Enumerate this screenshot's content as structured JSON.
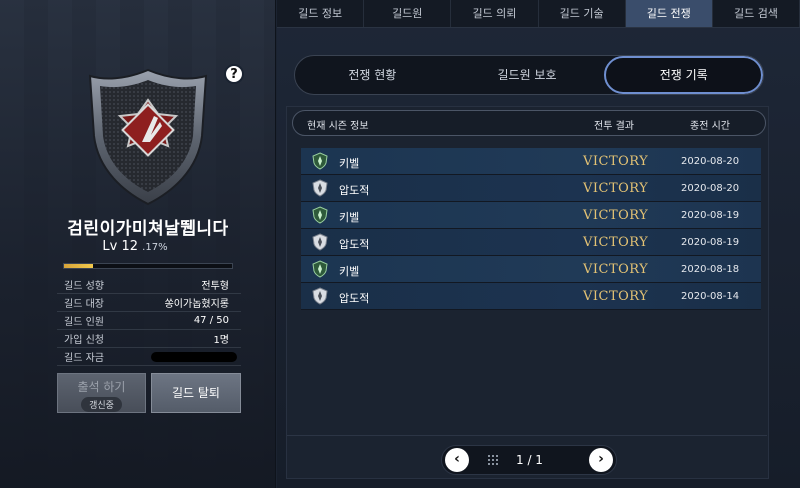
{
  "guild": {
    "name": "검린이가미쳐날뛥니다",
    "level_label": "Lv 12",
    "level_pct_text": ".17%",
    "level_progress": 0.17,
    "help_icon": "?",
    "info": [
      {
        "key": "길드 성향",
        "value": "전투형"
      },
      {
        "key": "길드 대장",
        "value": "쏭이가놉혔지롱"
      },
      {
        "key": "길드 인원",
        "value": "47 / 50"
      },
      {
        "key": "가입 신청",
        "value": "1명"
      },
      {
        "key": "길드 자금",
        "value": ""
      }
    ],
    "checkin_label": "출석 하기",
    "checkin_status": "갱신중",
    "leave_label": "길드 탈퇴"
  },
  "tabs": [
    "길드 정보",
    "길드원",
    "길드 의뢰",
    "길드 기술",
    "길드 전쟁",
    "길드 검색"
  ],
  "active_tab": 4,
  "subtabs": [
    "전쟁 현황",
    "길드원 보호",
    "전쟁 기록"
  ],
  "active_subtab": 2,
  "list": {
    "header_col1": "현재 시즌 정보",
    "header_col2": "전투 결과",
    "header_col3": "종전 시간",
    "rows": [
      {
        "opponent": "키벨",
        "result": "VICTORY",
        "date": "2020-08-20",
        "icon": "green-crest-icon"
      },
      {
        "opponent": "압도적",
        "result": "VICTORY",
        "date": "2020-08-20",
        "icon": "grey-crest-icon"
      },
      {
        "opponent": "키벨",
        "result": "VICTORY",
        "date": "2020-08-19",
        "icon": "green-crest-icon"
      },
      {
        "opponent": "압도적",
        "result": "VICTORY",
        "date": "2020-08-19",
        "icon": "grey-crest-icon"
      },
      {
        "opponent": "키벨",
        "result": "VICTORY",
        "date": "2020-08-18",
        "icon": "green-crest-icon"
      },
      {
        "opponent": "압도적",
        "result": "VICTORY",
        "date": "2020-08-14",
        "icon": "grey-crest-icon"
      }
    ]
  },
  "pager": {
    "text": "1 / 1",
    "prev": "‹",
    "next": "›"
  },
  "colors": {
    "accent": "#6f8fd0",
    "victory": "#e3c274",
    "active_tab": "#3a4d6b"
  }
}
